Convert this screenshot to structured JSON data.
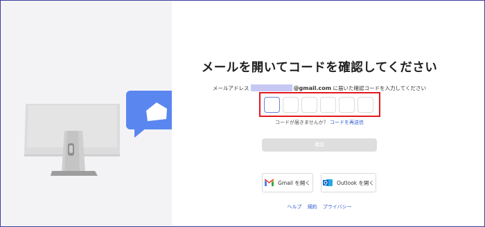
{
  "colors": {
    "accent": "#2f5bd3",
    "highlight_border": "#e3161c",
    "bubble": "#5a86f0",
    "left_panel_bg": "#f3f3f5"
  },
  "main": {
    "title": "メールを開いてコードを確認してください",
    "email_prefix": "メールアドレス",
    "email_domain": "@gmail.com",
    "email_suffix": " に届いた確認コードを入力してください",
    "code_cells": 6,
    "resend_question": "コードが届きませんか？",
    "resend_link": "コードを再送信",
    "confirm_label": "確認"
  },
  "buttons": {
    "gmail_label": "Gmail を開く",
    "gmail_icon": "gmail-icon",
    "outlook_label": "Outlook を開く",
    "outlook_icon": "outlook-icon"
  },
  "footer": {
    "help": "ヘルプ",
    "terms": "規約",
    "privacy": "プライバシー"
  },
  "illustration": {
    "monitor_icon": "monitor-icon",
    "bubble_icon": "mail-bubble-icon"
  }
}
